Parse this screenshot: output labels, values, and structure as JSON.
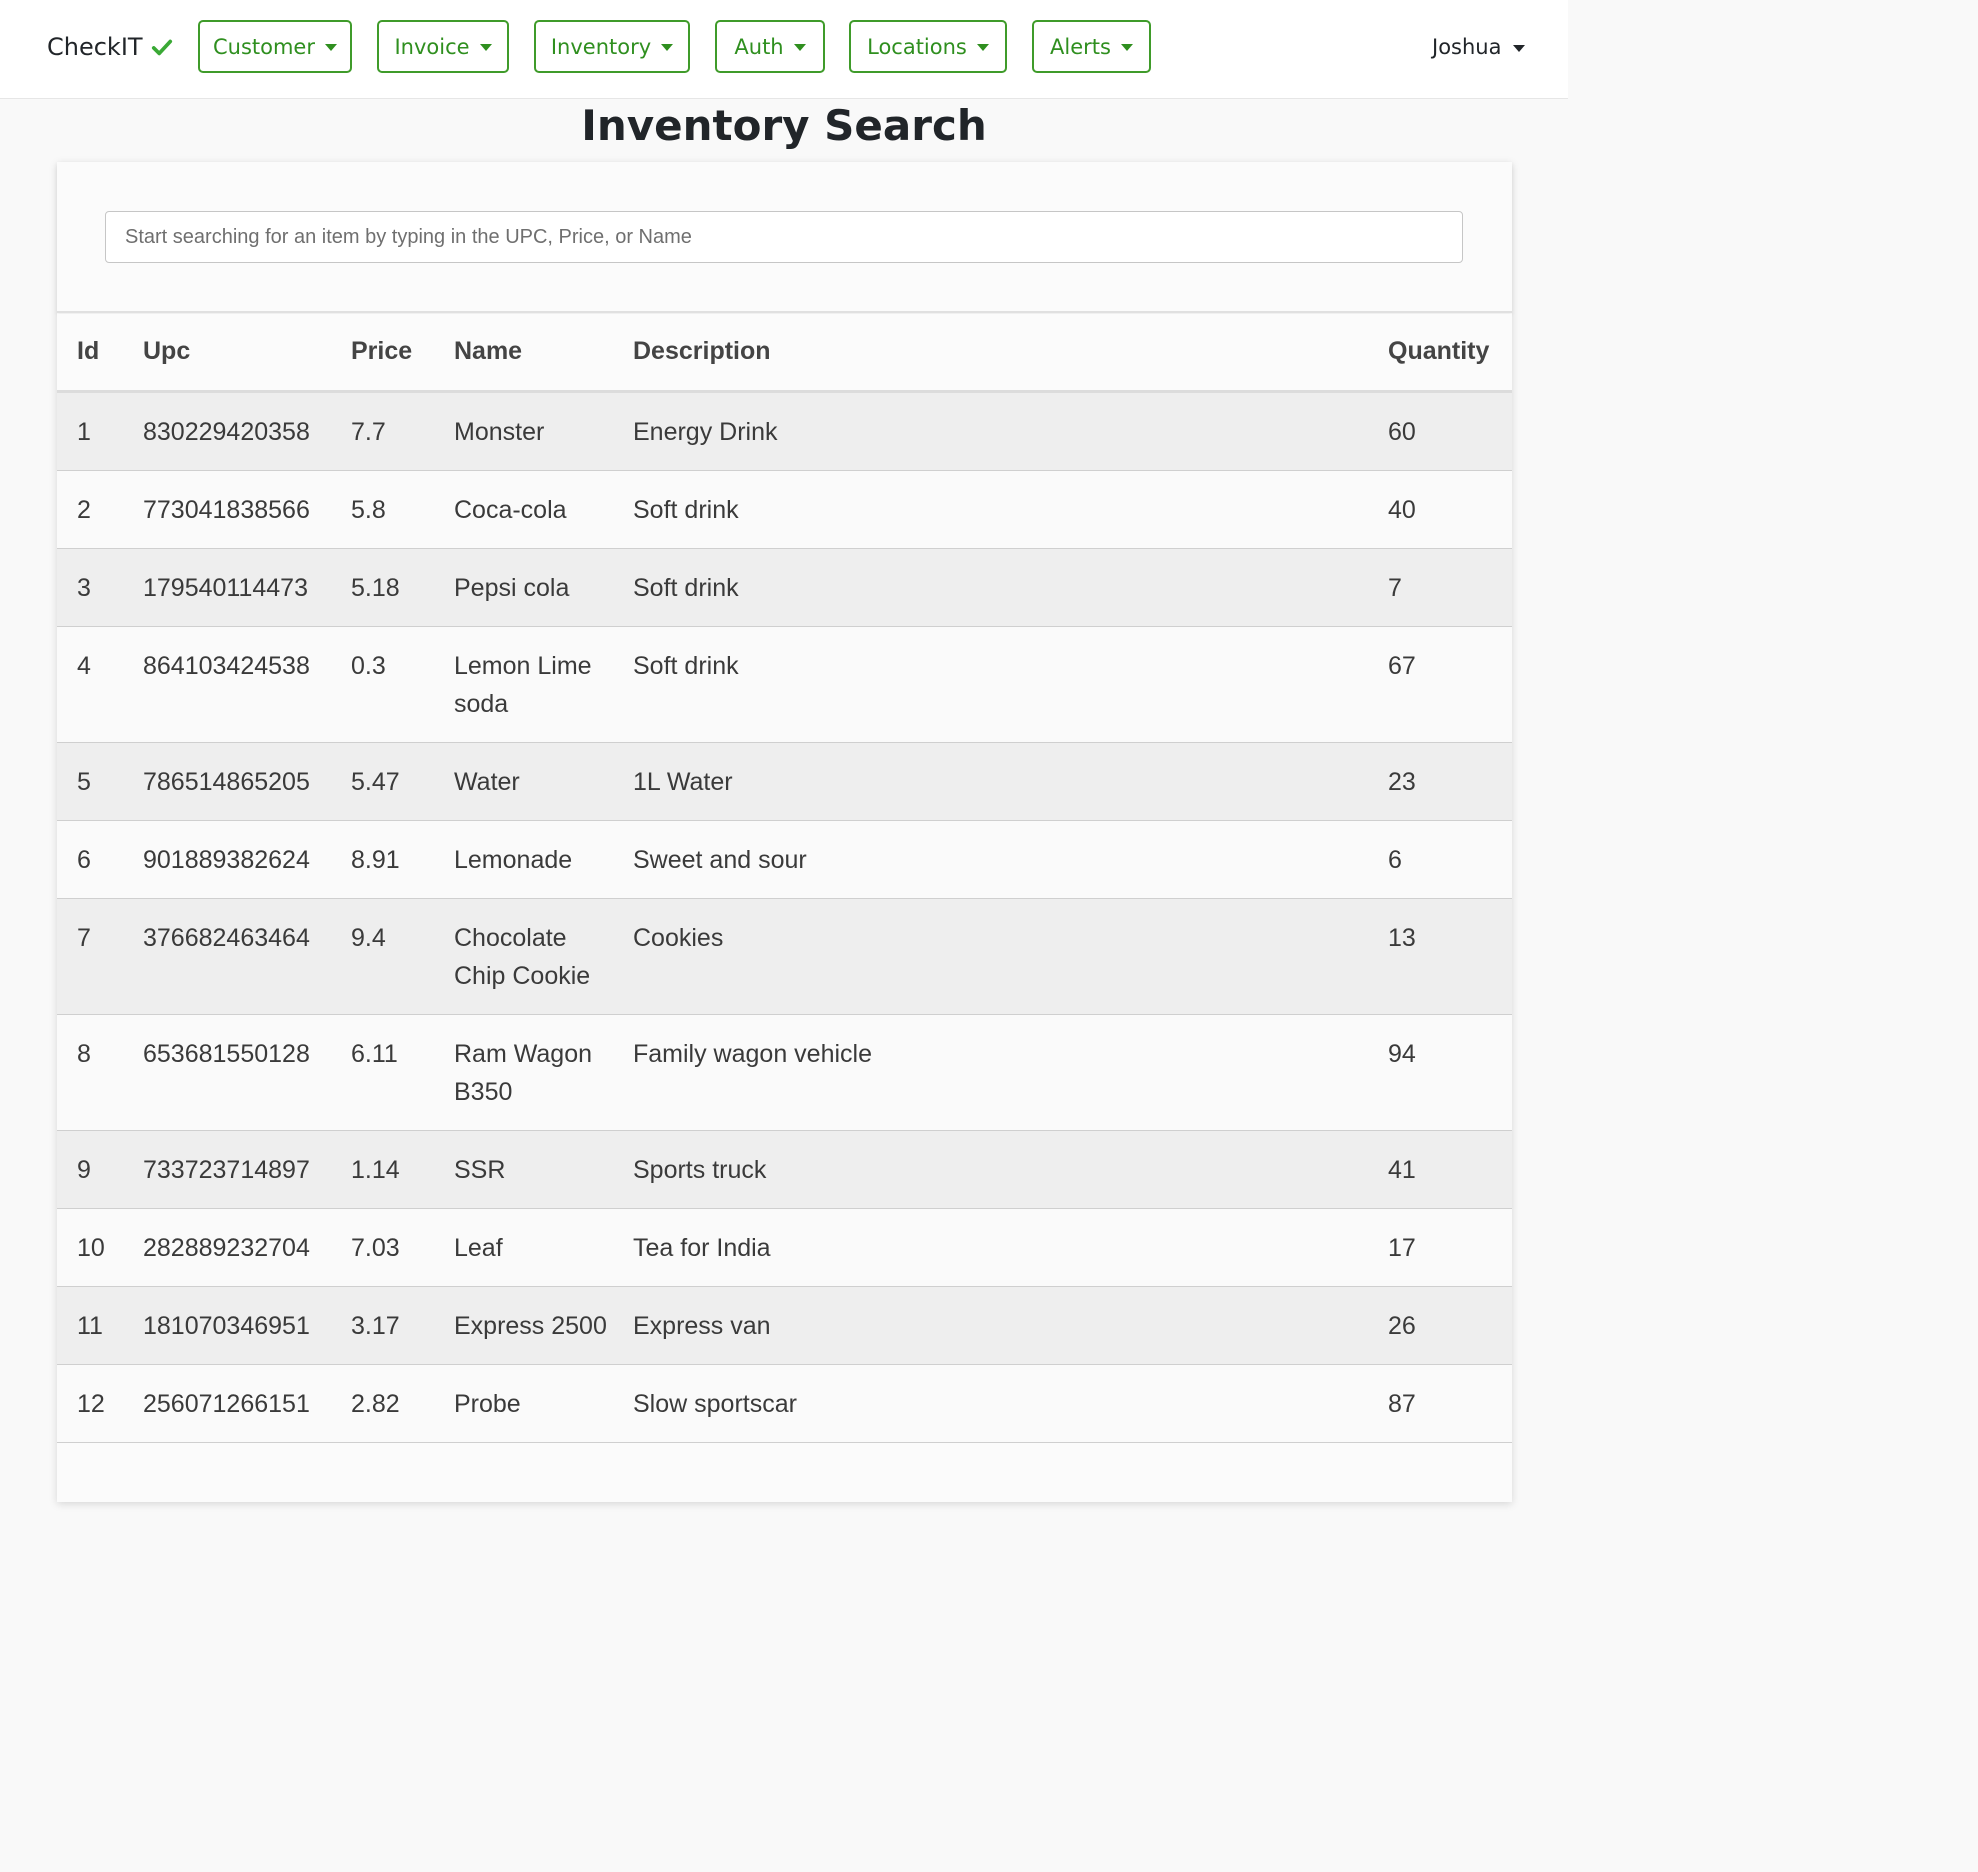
{
  "brand": {
    "name": "CheckIT",
    "icon": "checkmark-icon",
    "icon_color": "#3aa935"
  },
  "nav": {
    "menus": [
      {
        "label": "Customer"
      },
      {
        "label": "Invoice"
      },
      {
        "label": "Inventory"
      },
      {
        "label": "Auth"
      },
      {
        "label": "Locations"
      },
      {
        "label": "Alerts"
      }
    ],
    "user": "Joshua",
    "accent_color": "#3f9b2a"
  },
  "page": {
    "title": "Inventory Search"
  },
  "search": {
    "placeholder": "Start searching for an item by typing in the UPC, Price, or Name",
    "value": ""
  },
  "table": {
    "headers": [
      "Id",
      "Upc",
      "Price",
      "Name",
      "Description",
      "Quantity"
    ],
    "rows": [
      [
        "1",
        "830229420358",
        "7.7",
        "Monster",
        "Energy Drink",
        "60"
      ],
      [
        "2",
        "773041838566",
        "5.8",
        "Coca-cola",
        "Soft drink",
        "40"
      ],
      [
        "3",
        "179540114473",
        "5.18",
        "Pepsi cola",
        "Soft drink",
        "7"
      ],
      [
        "4",
        "864103424538",
        "0.3",
        "Lemon Lime soda",
        "Soft drink",
        "67"
      ],
      [
        "5",
        "786514865205",
        "5.47",
        "Water",
        "1L Water",
        "23"
      ],
      [
        "6",
        "901889382624",
        "8.91",
        "Lemonade",
        "Sweet and sour",
        "6"
      ],
      [
        "7",
        "376682463464",
        "9.4",
        "Chocolate Chip Cookie",
        "Cookies",
        "13"
      ],
      [
        "8",
        "653681550128",
        "6.11",
        "Ram Wagon B350",
        "Family wagon vehicle",
        "94"
      ],
      [
        "9",
        "733723714897",
        "1.14",
        "SSR",
        "Sports truck",
        "41"
      ],
      [
        "10",
        "282889232704",
        "7.03",
        "Leaf",
        "Tea for India",
        "17"
      ],
      [
        "11",
        "181070346951",
        "3.17",
        "Express 2500",
        "Express van",
        "26"
      ],
      [
        "12",
        "256071266151",
        "2.82",
        "Probe",
        "Slow sportscar",
        "87"
      ]
    ]
  }
}
